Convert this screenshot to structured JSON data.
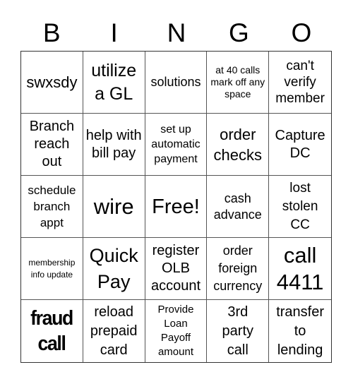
{
  "header": [
    "B",
    "I",
    "N",
    "G",
    "O"
  ],
  "cells": [
    {
      "text": "swxsdy"
    },
    {
      "text": "utilize a GL"
    },
    {
      "text": "solutions"
    },
    {
      "text": "at 40 calls mark off any space"
    },
    {
      "text": "can't verify member"
    },
    {
      "text": "Branch reach out"
    },
    {
      "text": "help with bill pay"
    },
    {
      "text": "set up automatic payment"
    },
    {
      "text": "order checks"
    },
    {
      "text": "Capture DC"
    },
    {
      "text": "schedule branch appt"
    },
    {
      "text": "wire"
    },
    {
      "text": "Free!",
      "free": true
    },
    {
      "text": "cash advance"
    },
    {
      "text": "lost stolen CC"
    },
    {
      "text": "membership info update"
    },
    {
      "text": "Quick Pay"
    },
    {
      "text": "register OLB account"
    },
    {
      "text": "order foreign currency"
    },
    {
      "text": "call 4411"
    },
    {
      "text": "fraud call",
      "bold": true
    },
    {
      "text": "reload prepaid card"
    },
    {
      "text": "Provide Loan Payoff amount"
    },
    {
      "text": "3rd party call"
    },
    {
      "text": "transfer to lending"
    }
  ]
}
